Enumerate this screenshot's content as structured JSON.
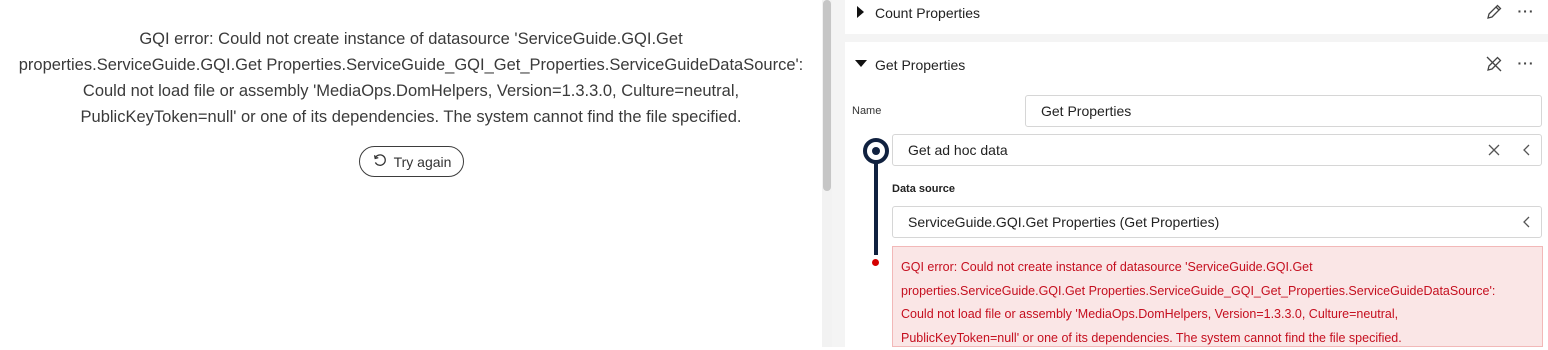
{
  "left_pane": {
    "error_message": "GQI error: Could not create instance of datasource 'ServiceGuide.GQI.Get\nproperties.ServiceGuide.GQI.Get Properties.ServiceGuide_GQI_Get_Properties.ServiceGuideDataSource':\nCould not load file or assembly 'MediaOps.DomHelpers, Version=1.3.3.0, Culture=neutral,\nPublicKeyToken=null' or one of its dependencies. The system cannot find the file specified.",
    "try_again_label": "Try again",
    "try_again_icon": "retry-icon"
  },
  "right_pane": {
    "sections": [
      {
        "title": "Count Properties",
        "expanded": false,
        "actions": [
          "edit-pencil-icon",
          "more-options-icon"
        ],
        "more_label": "···"
      },
      {
        "title": "Get Properties",
        "expanded": true,
        "actions": [
          "edit-off-icon",
          "more-options-icon"
        ],
        "more_label": "···",
        "name_label": "Name",
        "name_value": "Get Properties",
        "step": {
          "value": "Get ad hoc data",
          "icons": [
            "clear-icon",
            "chevron-left-icon"
          ]
        },
        "data_source_label": "Data source",
        "data_source_value": "ServiceGuide.GQI.Get Properties (Get Properties)",
        "error_message": "GQI error: Could not create instance of datasource 'ServiceGuide.GQI.Get\nproperties.ServiceGuide.GQI.Get Properties.ServiceGuide_GQI_Get_Properties.ServiceGuideDataSource':\nCould not load file or assembly 'MediaOps.DomHelpers, Version=1.3.3.0, Culture=neutral,\nPublicKeyToken=null' or one of its dependencies. The system cannot find the file specified."
      }
    ]
  },
  "colors": {
    "timeline": "#10213f",
    "error_text": "#c50f1f",
    "error_bg": "#fae6e6",
    "error_dot": "#d40000"
  }
}
